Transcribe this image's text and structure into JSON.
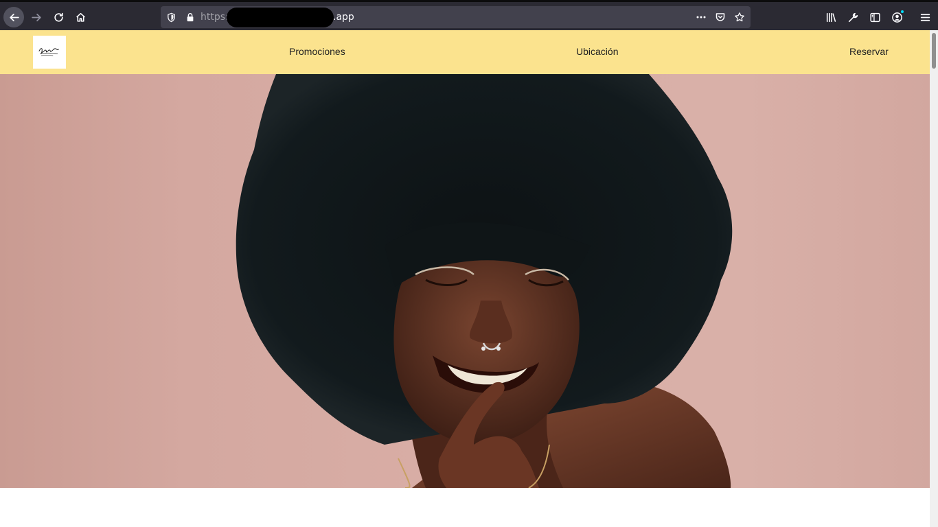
{
  "browser": {
    "url_prefix": "https:",
    "url_suffix": ".app",
    "icons": {
      "back": "arrow-left-icon",
      "forward": "arrow-right-icon",
      "reload": "reload-icon",
      "home": "home-icon",
      "tracking": "shield-icon",
      "lock": "lock-icon",
      "page_actions": "ellipsis-icon",
      "pocket": "pocket-icon",
      "bookmark": "star-icon",
      "library": "library-icon",
      "tools": "wrench-icon",
      "sidebar": "sidebar-icon",
      "account": "account-icon",
      "menu": "hamburger-menu-icon"
    }
  },
  "site": {
    "nav": {
      "promociones": "Promociones",
      "ubicacion": "Ubicación",
      "reservar": "Reservar"
    },
    "colors": {
      "navbar_bg": "#fbe38e",
      "hero_bg": "#d9aea6"
    }
  }
}
